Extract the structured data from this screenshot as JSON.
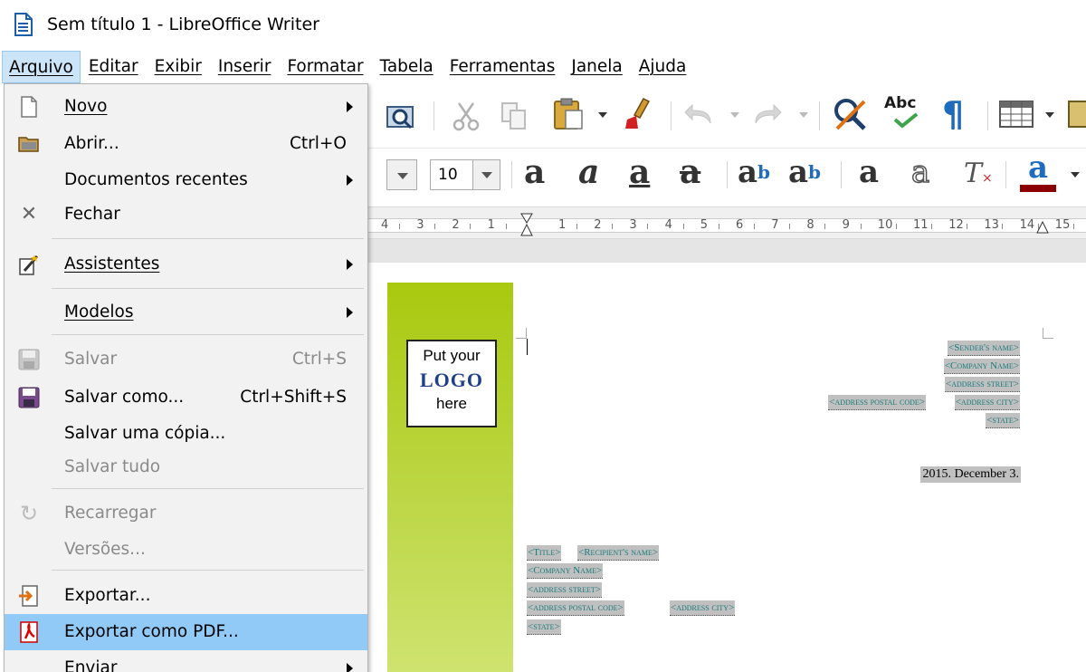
{
  "window": {
    "title": "Sem título 1 - LibreOffice Writer"
  },
  "menubar": [
    {
      "label": "Arquivo",
      "name": "menu-arquivo"
    },
    {
      "label": "Editar",
      "name": "menu-editar"
    },
    {
      "label": "Exibir",
      "name": "menu-exibir"
    },
    {
      "label": "Inserir",
      "name": "menu-inserir"
    },
    {
      "label": "Formatar",
      "name": "menu-formatar"
    },
    {
      "label": "Tabela",
      "name": "menu-tabela"
    },
    {
      "label": "Ferramentas",
      "name": "menu-ferramentas"
    },
    {
      "label": "Janela",
      "name": "menu-janela"
    },
    {
      "label": "Ajuda",
      "name": "menu-ajuda"
    }
  ],
  "file_menu": {
    "novo": "Novo",
    "abrir": "Abrir...",
    "abrir_shortcut": "Ctrl+O",
    "recentes": "Documentos recentes",
    "fechar": "Fechar",
    "assistentes": "Assistentes",
    "modelos": "Modelos",
    "salvar": "Salvar",
    "salvar_shortcut": "Ctrl+S",
    "salvar_como": "Salvar como...",
    "salvar_como_shortcut": "Ctrl+Shift+S",
    "salvar_copia": "Salvar uma cópia...",
    "salvar_tudo": "Salvar tudo",
    "recarregar": "Recarregar",
    "versoes": "Versões...",
    "exportar": "Exportar...",
    "exportar_pdf": "Exportar como PDF...",
    "enviar": "Enviar"
  },
  "toolbar": {
    "font_size": "10",
    "spell_label": "Abc",
    "colors": {
      "font_color": "#8b0000",
      "highlight_menu": "#91c9f7",
      "active_menu": "#cce4f7"
    }
  },
  "ruler": {
    "numbers": [
      "4",
      "3",
      "2",
      "1",
      "1",
      "2",
      "3",
      "4",
      "5",
      "6",
      "7",
      "8",
      "9",
      "10",
      "11",
      "12",
      "13",
      "14",
      "15"
    ]
  },
  "document": {
    "logo_line1": "Put your",
    "logo_line2": "LOGO",
    "logo_line3": "here",
    "sender_name": "<Sender's name>",
    "company_name": "<Company Name>",
    "address_street": "<address street>",
    "address_postal": "<address postal code>",
    "address_city": "<address city>",
    "state": "<state>",
    "date": "2015. December 3.",
    "r_title": "<Title>",
    "r_name": "<Recipient's name>",
    "r_company": "<Company Name>",
    "r_street": "<address street>",
    "r_postal": "<address postal code>",
    "r_city": "<address city>",
    "r_state": "<state>"
  }
}
